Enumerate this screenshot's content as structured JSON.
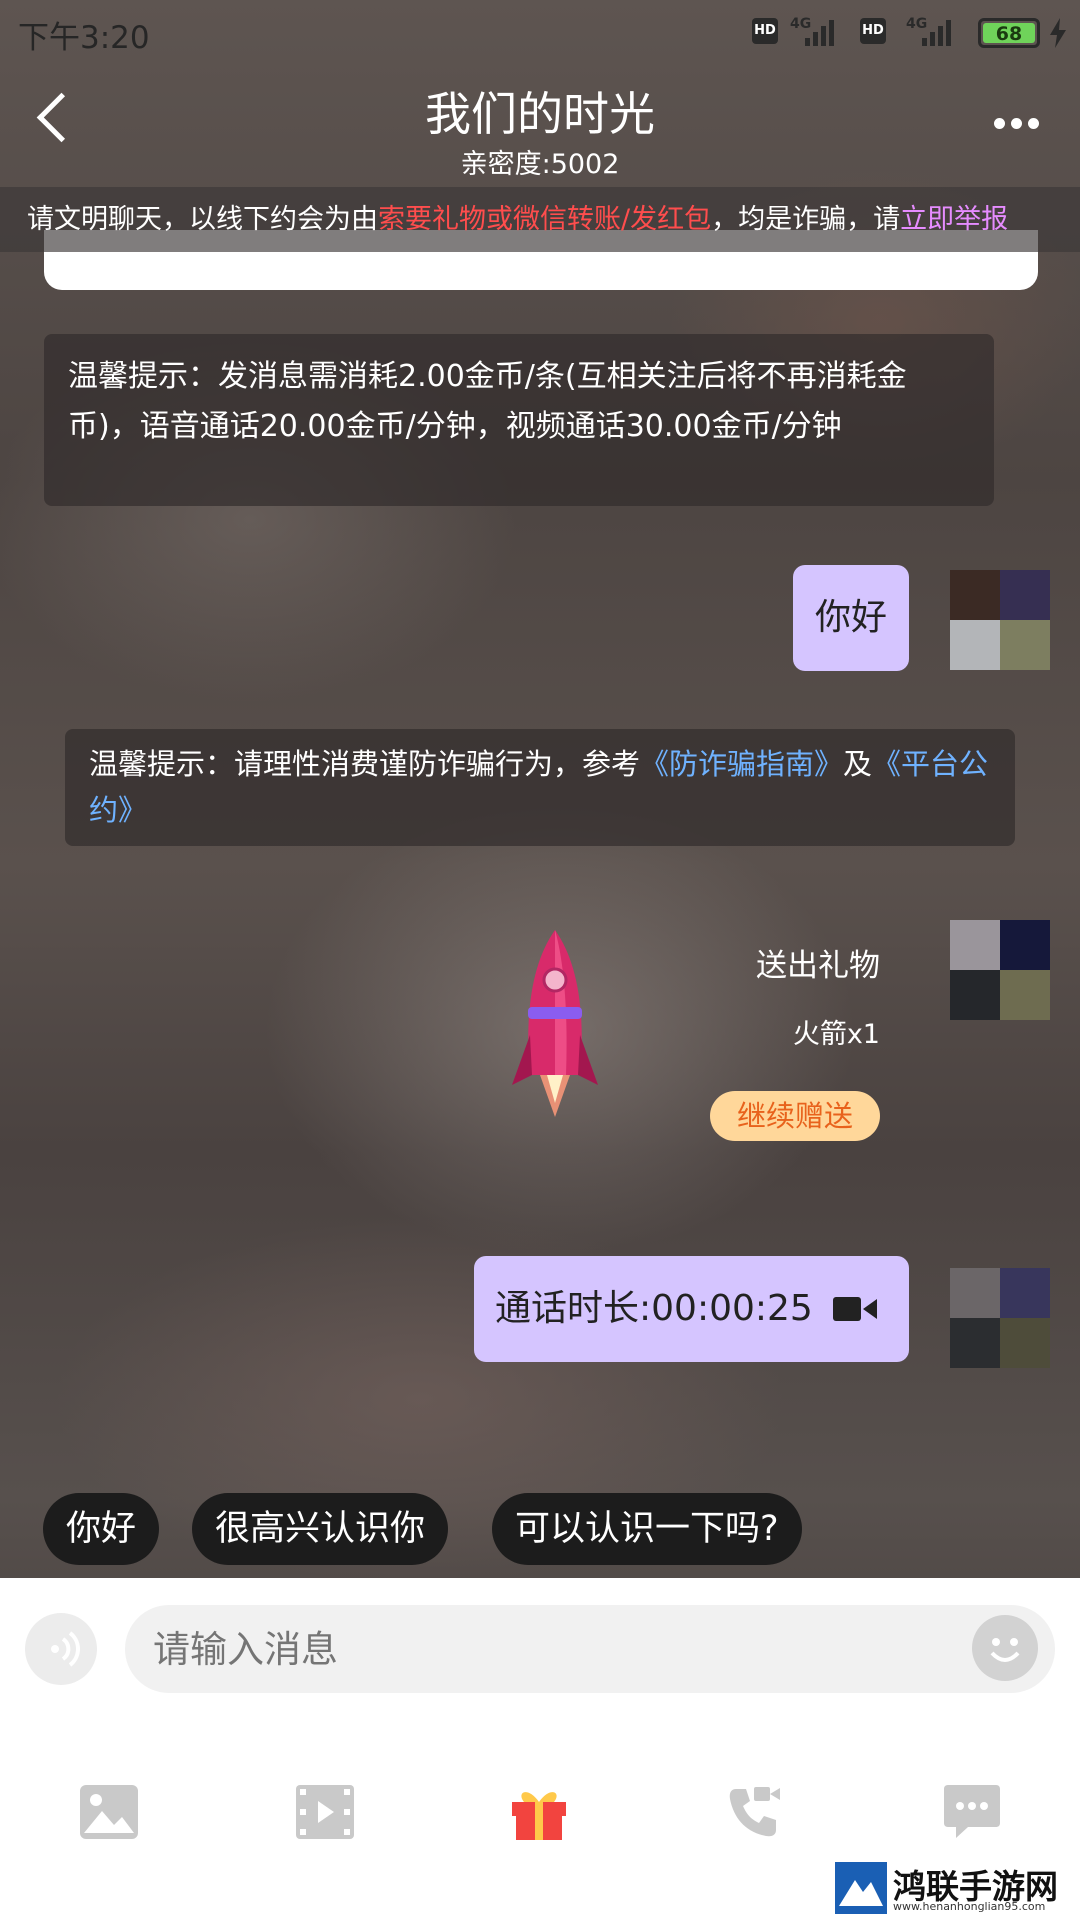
{
  "status_bar": {
    "time": "下午3:20",
    "hd": "HD",
    "network": "4G",
    "battery": "68"
  },
  "header": {
    "title": "我们的时光",
    "subtitle": "亲密度:5002"
  },
  "warning": {
    "prefix": "请文明聊天，以线下约会为由",
    "red": "索要礼物或微信转账/发红包",
    "middle": "，均是诈骗，请",
    "report_link": "立即举报"
  },
  "tip1": {
    "text": "温馨提示：发消息需消耗2.00金币/条(互相关注后将不再消耗金币)，语音通话20.00金币/分钟，视频通话30.00金币/分钟"
  },
  "tip2": {
    "prefix": "温馨提示：请理性消费谨防诈骗行为，参考",
    "link1": "《防诈骗指南》",
    "and": "及",
    "link2": "《平台公约》"
  },
  "messages": {
    "hello": "你好",
    "gift_title": "送出礼物",
    "gift_count": "火箭x1",
    "gift_button": "继续赠送",
    "call_duration": "通话时长:00:00:25"
  },
  "quick_replies": [
    "你好",
    "很高兴认识你",
    "可以认识一下吗?"
  ],
  "input": {
    "placeholder": "请输入消息"
  },
  "toolbar": [
    "image-icon",
    "video-icon",
    "gift-icon",
    "video-call-icon",
    "more-chat-icon"
  ],
  "watermark": {
    "name": "鸿联手游网",
    "url": "www.henanhonglian95.com"
  },
  "colors": {
    "bubble": "#d5c5ff",
    "warning_red": "#ff4d4d",
    "report_pink": "#e68cff",
    "link_blue": "#6fb2ff",
    "gift_button_bg": "#ffd79a",
    "gift_button_text": "#e8621c"
  }
}
